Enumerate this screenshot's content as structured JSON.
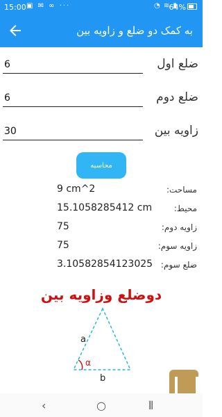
{
  "status_bar": {
    "time": "15:00",
    "battery": "64%"
  },
  "app_bar": {
    "title": "به کمک دو ضلع و زاویه بین"
  },
  "inputs": [
    {
      "label": "ضلع اول",
      "value": "6"
    },
    {
      "label": "ضلع دوم",
      "value": "6"
    },
    {
      "label": "زاویه بین",
      "value": "30"
    }
  ],
  "calculate_button": {
    "label": "محاسبه"
  },
  "results": [
    {
      "label": "مساحت:",
      "value": "9 cm^2"
    },
    {
      "label": "محیط:",
      "value": "15.1058285412 cm"
    },
    {
      "label": "زاویه دوم:",
      "value": "75"
    },
    {
      "label": "زاویه سوم:",
      "value": "75"
    },
    {
      "label": "ضلع سوم:",
      "value": "3.10582854123025"
    }
  ],
  "diagram": {
    "title": "دوضلع وزاویه بین",
    "side_a": "a",
    "side_b": "b",
    "angle": "α"
  },
  "colors": {
    "primary": "#2196f3",
    "button": "#32b5f5",
    "diagram_title": "#d01010"
  }
}
